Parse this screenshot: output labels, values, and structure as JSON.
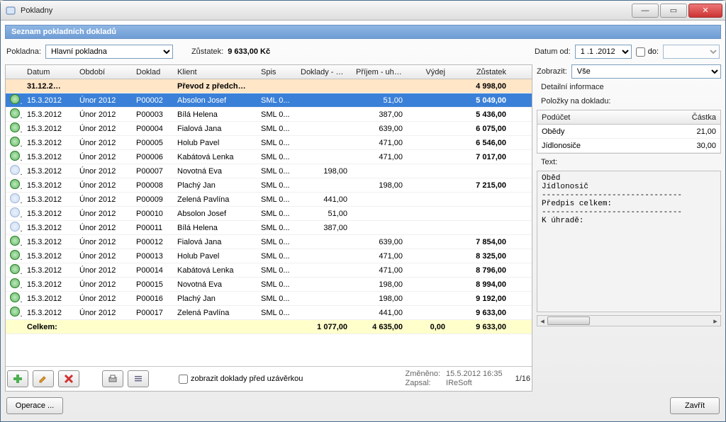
{
  "window": {
    "title": "Pokladny"
  },
  "section_title": "Seznam pokladních dokladů",
  "top": {
    "pokladna_label": "Pokladna:",
    "pokladna_value": "Hlavní pokladna",
    "zustatek_label": "Zůstatek:",
    "zustatek_value": "9 633,00 Kč",
    "datum_od_label": "Datum od:",
    "datum_od_value": "1 .1 .2012",
    "do_label": "do:",
    "do_value": ""
  },
  "columns": {
    "datum": "Datum",
    "obdobi": "Období",
    "doklad": "Doklad",
    "klient": "Klient",
    "spis": "Spis",
    "doklady_vy": "Doklady - vy...",
    "prijem_uhr": "Příjem - uhr...",
    "vydej": "Výdej",
    "zustatek": "Zůstatek"
  },
  "opening": {
    "datum": "31.12.2…",
    "klient": "Převod z předch…",
    "zustatek": "4 998,00"
  },
  "rows": [
    {
      "ok": true,
      "sel": true,
      "datum": "15.3.2012",
      "obdobi": "Únor 2012",
      "doklad": "P00002",
      "klient": "Absolon Josef",
      "spis": "SML 0...",
      "dv": "",
      "pu": "51,00",
      "vy": "",
      "zu": "5 049,00"
    },
    {
      "ok": true,
      "datum": "15.3.2012",
      "obdobi": "Únor 2012",
      "doklad": "P00003",
      "klient": "Bílá Helena",
      "spis": "SML 0...",
      "dv": "",
      "pu": "387,00",
      "vy": "",
      "zu": "5 436,00"
    },
    {
      "ok": true,
      "datum": "15.3.2012",
      "obdobi": "Únor 2012",
      "doklad": "P00004",
      "klient": "Fialová Jana",
      "spis": "SML 0...",
      "dv": "",
      "pu": "639,00",
      "vy": "",
      "zu": "6 075,00"
    },
    {
      "ok": true,
      "datum": "15.3.2012",
      "obdobi": "Únor 2012",
      "doklad": "P00005",
      "klient": "Holub Pavel",
      "spis": "SML 0...",
      "dv": "",
      "pu": "471,00",
      "vy": "",
      "zu": "6 546,00"
    },
    {
      "ok": true,
      "datum": "15.3.2012",
      "obdobi": "Únor 2012",
      "doklad": "P00006",
      "klient": "Kabátová Lenka",
      "spis": "SML 0...",
      "dv": "",
      "pu": "471,00",
      "vy": "",
      "zu": "7 017,00"
    },
    {
      "ok": false,
      "datum": "15.3.2012",
      "obdobi": "Únor 2012",
      "doklad": "P00007",
      "klient": "Novotná Eva",
      "spis": "SML 0...",
      "dv": "198,00",
      "pu": "",
      "vy": "",
      "zu": ""
    },
    {
      "ok": true,
      "datum": "15.3.2012",
      "obdobi": "Únor 2012",
      "doklad": "P00008",
      "klient": "Plachý Jan",
      "spis": "SML 0...",
      "dv": "",
      "pu": "198,00",
      "vy": "",
      "zu": "7 215,00"
    },
    {
      "ok": false,
      "datum": "15.3.2012",
      "obdobi": "Únor 2012",
      "doklad": "P00009",
      "klient": "Zelená Pavlína",
      "spis": "SML 0...",
      "dv": "441,00",
      "pu": "",
      "vy": "",
      "zu": ""
    },
    {
      "ok": false,
      "datum": "15.3.2012",
      "obdobi": "Únor 2012",
      "doklad": "P00010",
      "klient": "Absolon Josef",
      "spis": "SML 0...",
      "dv": "51,00",
      "pu": "",
      "vy": "",
      "zu": ""
    },
    {
      "ok": false,
      "datum": "15.3.2012",
      "obdobi": "Únor 2012",
      "doklad": "P00011",
      "klient": "Bílá Helena",
      "spis": "SML 0...",
      "dv": "387,00",
      "pu": "",
      "vy": "",
      "zu": ""
    },
    {
      "ok": true,
      "datum": "15.3.2012",
      "obdobi": "Únor 2012",
      "doklad": "P00012",
      "klient": "Fialová Jana",
      "spis": "SML 0...",
      "dv": "",
      "pu": "639,00",
      "vy": "",
      "zu": "7 854,00"
    },
    {
      "ok": true,
      "datum": "15.3.2012",
      "obdobi": "Únor 2012",
      "doklad": "P00013",
      "klient": "Holub Pavel",
      "spis": "SML 0...",
      "dv": "",
      "pu": "471,00",
      "vy": "",
      "zu": "8 325,00"
    },
    {
      "ok": true,
      "datum": "15.3.2012",
      "obdobi": "Únor 2012",
      "doklad": "P00014",
      "klient": "Kabátová Lenka",
      "spis": "SML 0...",
      "dv": "",
      "pu": "471,00",
      "vy": "",
      "zu": "8 796,00"
    },
    {
      "ok": true,
      "datum": "15.3.2012",
      "obdobi": "Únor 2012",
      "doklad": "P00015",
      "klient": "Novotná Eva",
      "spis": "SML 0...",
      "dv": "",
      "pu": "198,00",
      "vy": "",
      "zu": "8 994,00"
    },
    {
      "ok": true,
      "datum": "15.3.2012",
      "obdobi": "Únor 2012",
      "doklad": "P00016",
      "klient": "Plachý Jan",
      "spis": "SML 0...",
      "dv": "",
      "pu": "198,00",
      "vy": "",
      "zu": "9 192,00"
    },
    {
      "ok": true,
      "datum": "15.3.2012",
      "obdobi": "Únor 2012",
      "doklad": "P00017",
      "klient": "Zelená Pavlína",
      "spis": "SML 0...",
      "dv": "",
      "pu": "441,00",
      "vy": "",
      "zu": "9 633,00"
    }
  ],
  "sum": {
    "label": "Celkem:",
    "dv": "1 077,00",
    "pu": "4 635,00",
    "vy": "0,00",
    "zu": "9 633,00"
  },
  "footer": {
    "chk_label": "zobrazit doklady před uzávěrkou",
    "meta": {
      "zmeneno_l": "Změněno:",
      "zmeneno_v": "15.5.2012 16:35",
      "zapsal_l": "Zapsal:",
      "zapsal_v": "IReSoft"
    },
    "pager": "1/16"
  },
  "bottom": {
    "operace": "Operace ...",
    "zavrit": "Zavřít"
  },
  "detail": {
    "zobrazit_label": "Zobrazit:",
    "zobrazit_value": "Vše",
    "info_label": "Detailní informace",
    "polozky_label": "Položky na dokladu:",
    "cols": {
      "poducet": "Podúčet",
      "castka": "Částka"
    },
    "items": [
      {
        "n": "Obědy",
        "v": "21,00"
      },
      {
        "n": "Jídlonosiče",
        "v": "30,00"
      }
    ],
    "text_label": "Text:",
    "text_body": "Oběd\nJídlonosič\n------------------------------\nPředpis celkem:\n------------------------------\nK úhradě:"
  }
}
